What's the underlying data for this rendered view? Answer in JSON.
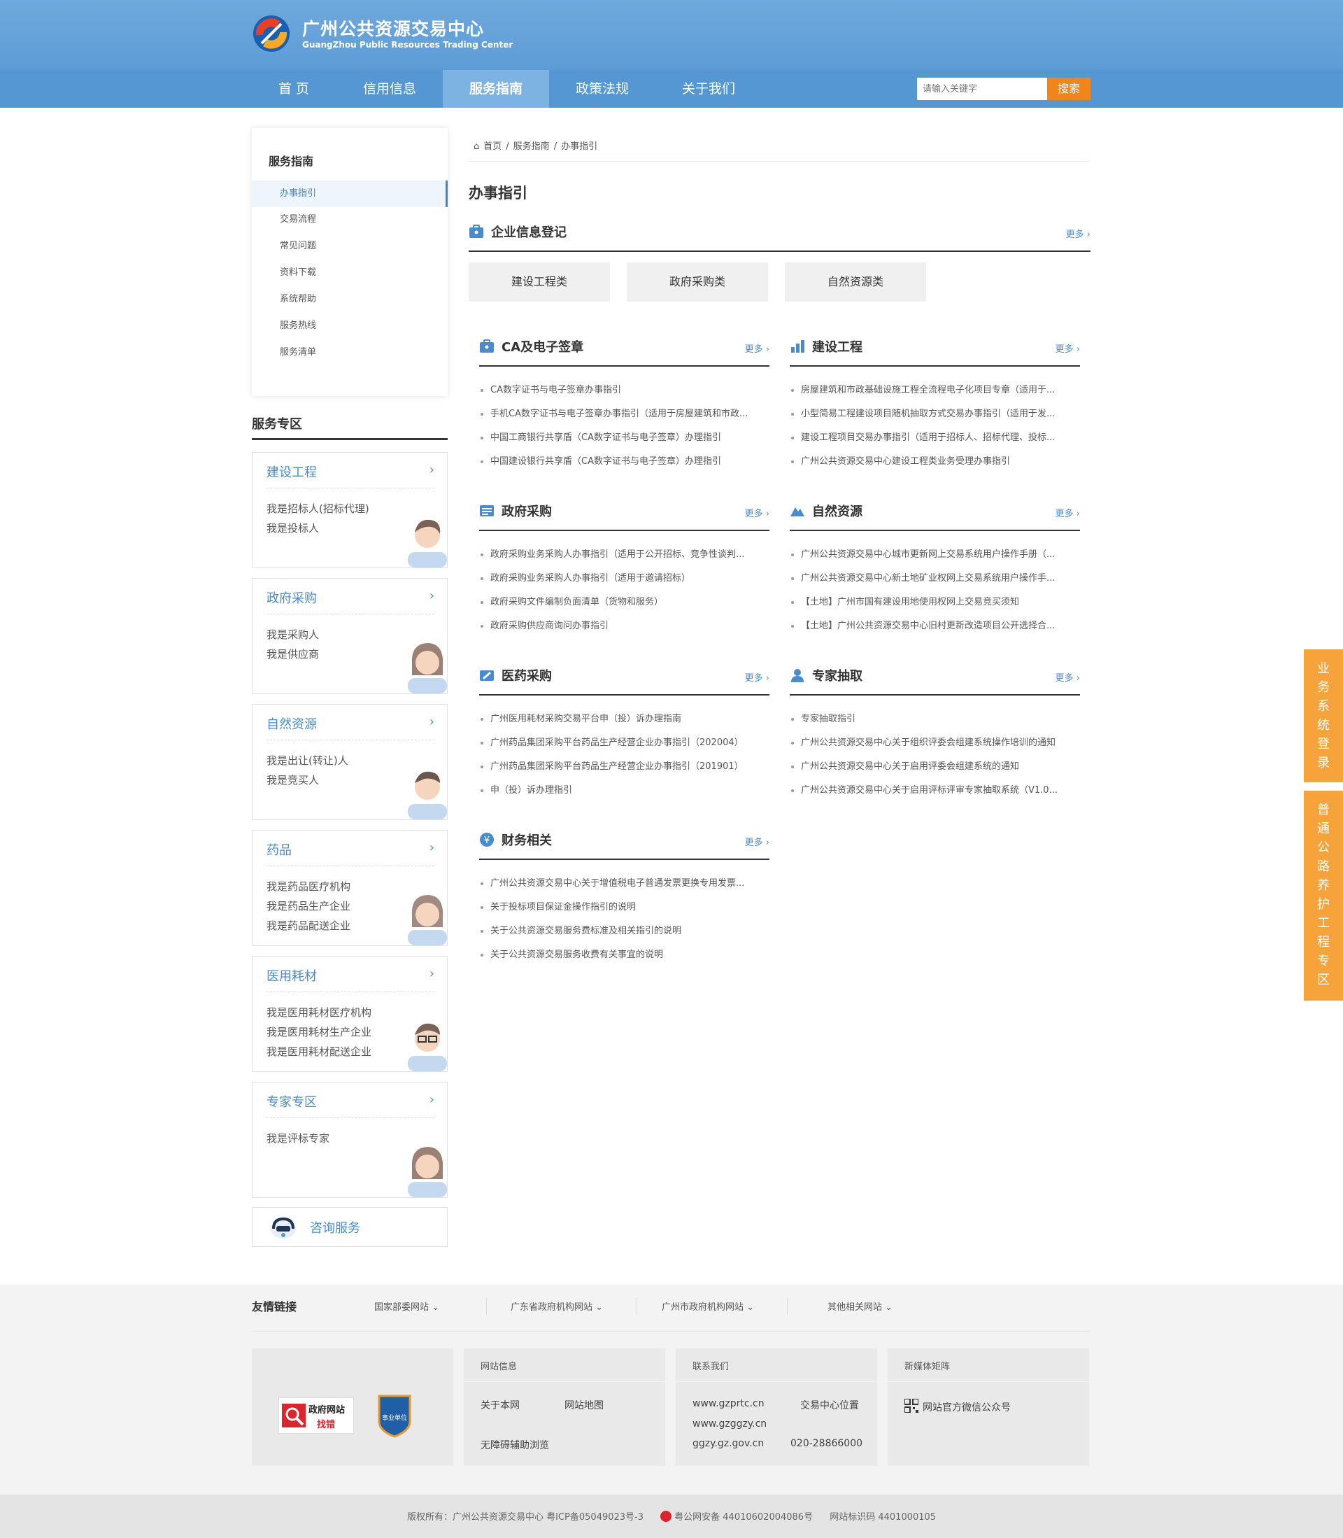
{
  "header": {
    "site_name_cn": "广州公共资源交易中心",
    "site_name_en": "GuangZhou Public Resources Trading Center",
    "nav": [
      "首 页",
      "信用信息",
      "服务指南",
      "政策法规",
      "关于我们"
    ],
    "active_nav": "服务指南",
    "search_placeholder": "请输入关键字",
    "search_button": "搜索"
  },
  "sidebar": {
    "title": "服务指南",
    "items": [
      "办事指引",
      "交易流程",
      "常见问题",
      "资料下载",
      "系统帮助",
      "服务热线",
      "服务清单"
    ],
    "active_item": "办事指引"
  },
  "service_zone": {
    "title": "服务专区",
    "cards": [
      {
        "title": "建设工程",
        "lines": [
          "我是招标人(招标代理)",
          "我是投标人"
        ]
      },
      {
        "title": "政府采购",
        "lines": [
          "我是采购人",
          "我是供应商"
        ]
      },
      {
        "title": "自然资源",
        "lines": [
          "我是出让(转让)人",
          "我是竞买人"
        ]
      },
      {
        "title": "药品",
        "lines": [
          "我是药品医疗机构",
          "我是药品生产企业",
          "我是药品配送企业"
        ]
      },
      {
        "title": "医用耗材",
        "lines": [
          "我是医用耗材医疗机构",
          "我是医用耗材生产企业",
          "我是医用耗材配送企业"
        ]
      },
      {
        "title": "专家专区",
        "lines": [
          "我是评标专家"
        ]
      }
    ],
    "consult_label": "咨询服务"
  },
  "breadcrumb": [
    "首页",
    "/",
    "服务指南",
    "/",
    "办事指引"
  ],
  "page_title": "办事指引",
  "more_label": "更多 ›",
  "enterprise_registration": {
    "title": "企业信息登记",
    "buttons": [
      "建设工程类",
      "政府采购类",
      "自然资源类"
    ]
  },
  "sections": [
    {
      "title": "CA及电子签章",
      "items": [
        "CA数字证书与电子签章办事指引",
        "手机CA数字证书与电子签章办事指引（适用于房屋建筑和市政...",
        "中国工商银行共享盾（CA数字证书与电子签章）办理指引",
        "中国建设银行共享盾（CA数字证书与电子签章）办理指引"
      ]
    },
    {
      "title": "建设工程",
      "items": [
        "房屋建筑和市政基础设施工程全流程电子化项目专章（适用于...",
        "小型简易工程建设项目随机抽取方式交易办事指引（适用于发...",
        "建设工程项目交易办事指引（适用于招标人、招标代理、投标...",
        "广州公共资源交易中心建设工程类业务受理办事指引"
      ]
    },
    {
      "title": "政府采购",
      "items": [
        "政府采购业务采购人办事指引（适用于公开招标、竞争性谈判...",
        "政府采购业务采购人办事指引（适用于邀请招标）",
        "政府采购文件编制负面清单（货物和服务）",
        "政府采购供应商询问办事指引"
      ]
    },
    {
      "title": "自然资源",
      "items": [
        "广州公共资源交易中心城市更新网上交易系统用户操作手册（...",
        "广州公共资源交易中心新土地矿业权网上交易系统用户操作手...",
        "【土地】广州市国有建设用地使用权网上交易竞买须知",
        "【土地】广州公共资源交易中心旧村更新改造项目公开选择合..."
      ]
    },
    {
      "title": "医药采购",
      "items": [
        "广州医用耗材采购交易平台申（投）诉办理指南",
        "广州药品集团采购平台药品生产经营企业办事指引（202004）",
        "广州药品集团采购平台药品生产经营企业办事指引（201901）",
        "申（投）诉办理指引"
      ]
    },
    {
      "title": "专家抽取",
      "items": [
        "专家抽取指引",
        "广州公共资源交易中心关于组织评委会组建系统操作培训的通知",
        "广州公共资源交易中心关于启用评委会组建系统的通知",
        "广州公共资源交易中心关于启用评标评审专家抽取系统（V1.0..."
      ]
    },
    {
      "title": "财务相关",
      "items": [
        "广州公共资源交易中心关于增值税电子普通发票更换专用发票...",
        "关于投标项目保证金操作指引的说明",
        "关于公共资源交易服务费标准及相关指引的说明",
        "关于公共资源交易服务收费有关事宜的说明"
      ]
    }
  ],
  "float_tabs": [
    "业务系统登录",
    "普通公路养护工程专区"
  ],
  "footer": {
    "friend_links_title": "友情链接",
    "friend_links": [
      "国家部委网站 ⌄",
      "广东省政府机构网站 ⌄",
      "广州市政府机构网站 ⌄",
      "其他相关网站 ⌄"
    ],
    "badge_gov_line1": "政府网站",
    "badge_gov_line2": "找错",
    "badge_inst": "事业单位",
    "site_info": {
      "title": "网站信息",
      "links": [
        "关于本网",
        "网站地图",
        "无障碍辅助浏览"
      ]
    },
    "contact": {
      "title": "联系我们",
      "links": [
        "www.gzprtc.cn",
        "交易中心位置",
        "www.gzggzy.cn",
        "ggzy.gz.gov.cn",
        "020-28866000"
      ]
    },
    "media": {
      "title": "新媒体矩阵",
      "wechat": "网站官方微信公众号"
    },
    "copyright": "版权所有：广州公共资源交易中心    粤ICP备05049023号-3",
    "police": "粤公网安备 44010602004086号",
    "site_code": "网站标识码 4401000105"
  },
  "colors": {
    "brand_blue": "#5497d3",
    "accent_orange": "#f08519",
    "float_orange": "#f6a33c",
    "link_blue": "#4a8bcb"
  }
}
